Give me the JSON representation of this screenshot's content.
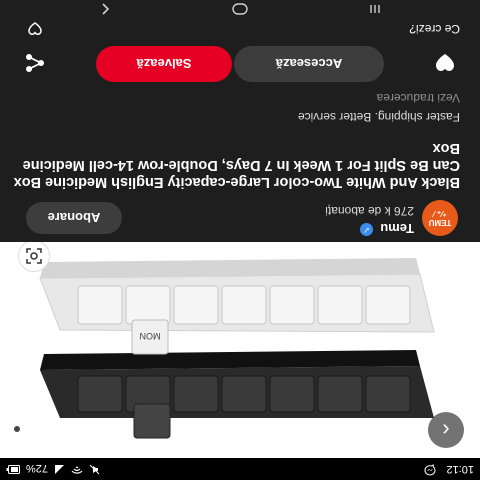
{
  "status_bar": {
    "time": "10:12",
    "notification_icon": "messenger-icon",
    "battery_percent": "72%",
    "icons": [
      "mute-icon",
      "wifi-icon",
      "signal-icon",
      "battery-icon"
    ]
  },
  "pin": {
    "brand": {
      "name": "Temu",
      "avatar_line1": "TEMU",
      "avatar_line2": "⁺⁄₊ ⁄",
      "followers": "276 k de abonați",
      "verified": true
    },
    "follow_label": "Abonare",
    "title": "Black And White Two-color Large-capacity English Medicine Box Can Be Split For 1 Week In 7 Days, Double-row 14-cell Medicine Box",
    "subtitle": "Faster shipping. Better service",
    "translate_label": "Vezi traducerea"
  },
  "actions": {
    "visit_label": "Accesează",
    "save_label": "Salvează",
    "reaction_prompt": "Ce crezi?"
  },
  "colors": {
    "background": "#1e1e1e",
    "save_button": "#e60023",
    "secondary_button": "#3d3d3d",
    "avatar": "#e85a1a"
  },
  "nav_bar": [
    "recent-apps-icon",
    "home-icon",
    "back-icon"
  ]
}
